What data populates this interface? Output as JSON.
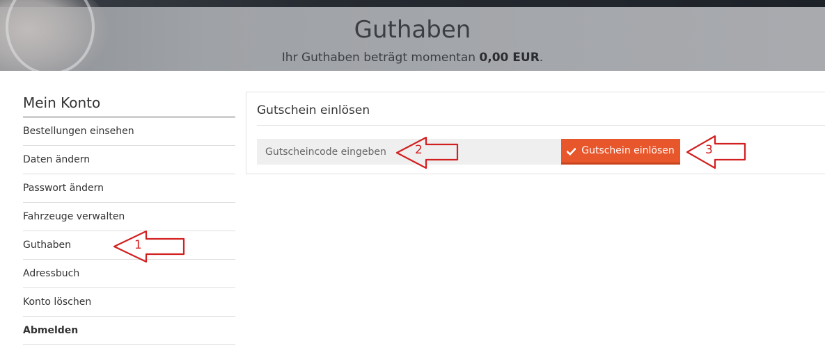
{
  "hero": {
    "title": "Guthaben",
    "balance_prefix": "Ihr Guthaben beträgt momentan ",
    "balance_value": "0,00 EUR",
    "balance_suffix": "."
  },
  "sidebar": {
    "title": "Mein Konto",
    "items": [
      {
        "label": "Bestellungen einsehen",
        "bold": false
      },
      {
        "label": "Daten ändern",
        "bold": false
      },
      {
        "label": "Passwort ändern",
        "bold": false
      },
      {
        "label": "Fahrzeuge verwalten",
        "bold": false
      },
      {
        "label": "Guthaben",
        "bold": false
      },
      {
        "label": "Adressbuch",
        "bold": false
      },
      {
        "label": "Konto löschen",
        "bold": false
      },
      {
        "label": "Abmelden",
        "bold": true
      }
    ]
  },
  "voucher": {
    "panel_title": "Gutschein einlösen",
    "input_placeholder": "Gutscheincode eingeben",
    "input_value": "",
    "button_label": "Gutschein einlösen",
    "button_icon": "check-icon",
    "button_color": "#e8562b"
  },
  "annotations": {
    "arrow_color": "#d21f1f",
    "labels": [
      "1",
      "2",
      "3"
    ]
  }
}
